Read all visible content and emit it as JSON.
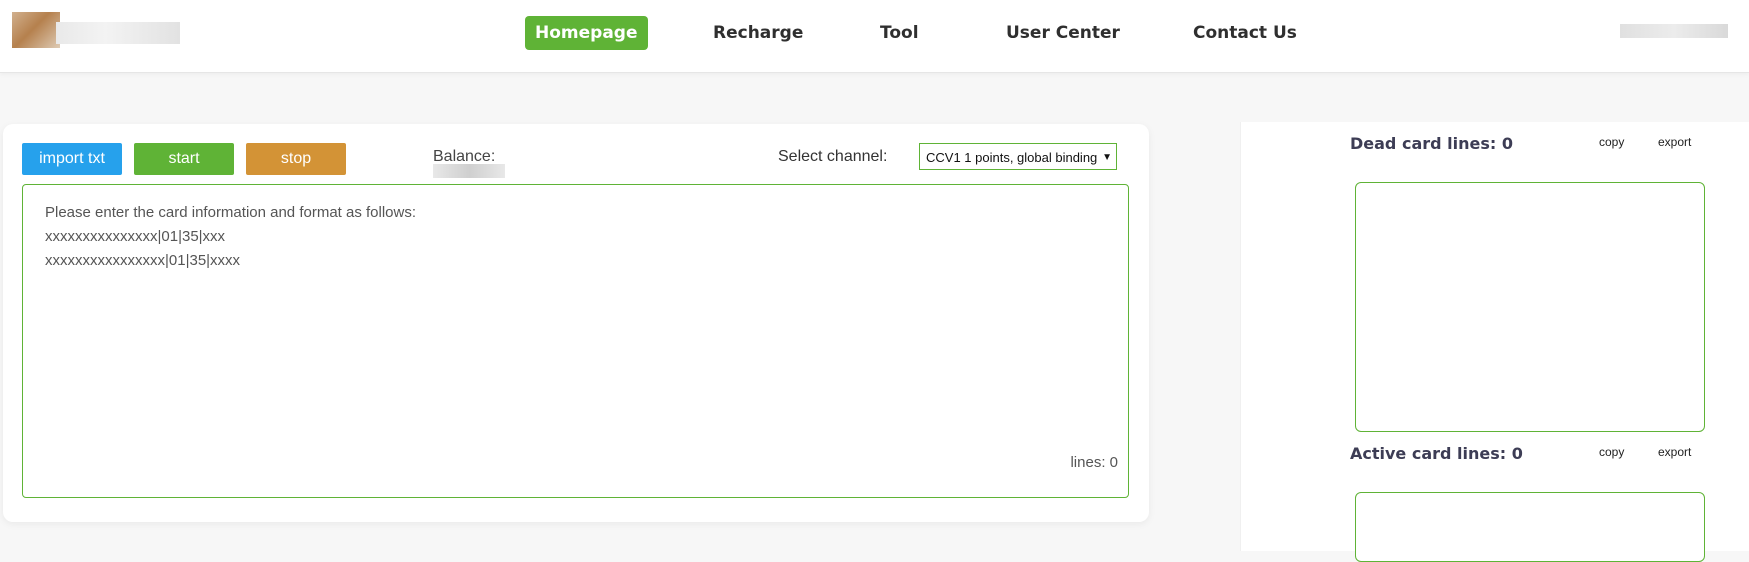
{
  "header": {
    "nav": [
      "Homepage",
      "Recharge",
      "Tool",
      "User Center",
      "Contact Us"
    ],
    "active_nav": "Homepage"
  },
  "main": {
    "buttons": {
      "import": "import txt",
      "start": "start",
      "stop": "stop"
    },
    "balance_label": "Balance:",
    "channel_label": "Select channel:",
    "channel_selected": "CCV1 1 points, global binding",
    "textarea_placeholder": "Please enter the card information and format as follows:\nxxxxxxxxxxxxxxx|01|35|xxx\nxxxxxxxxxxxxxxxx|01|35|xxxx",
    "lines_label": "lines: 0"
  },
  "sidebar": {
    "dead": {
      "title": "Dead card lines: 0",
      "copy": "copy",
      "export": "export"
    },
    "active": {
      "title": "Active card lines: 0",
      "copy": "copy",
      "export": "export"
    }
  },
  "colors": {
    "accent_green": "#5fb336",
    "blue": "#26a1ec",
    "orange": "#d39336"
  }
}
